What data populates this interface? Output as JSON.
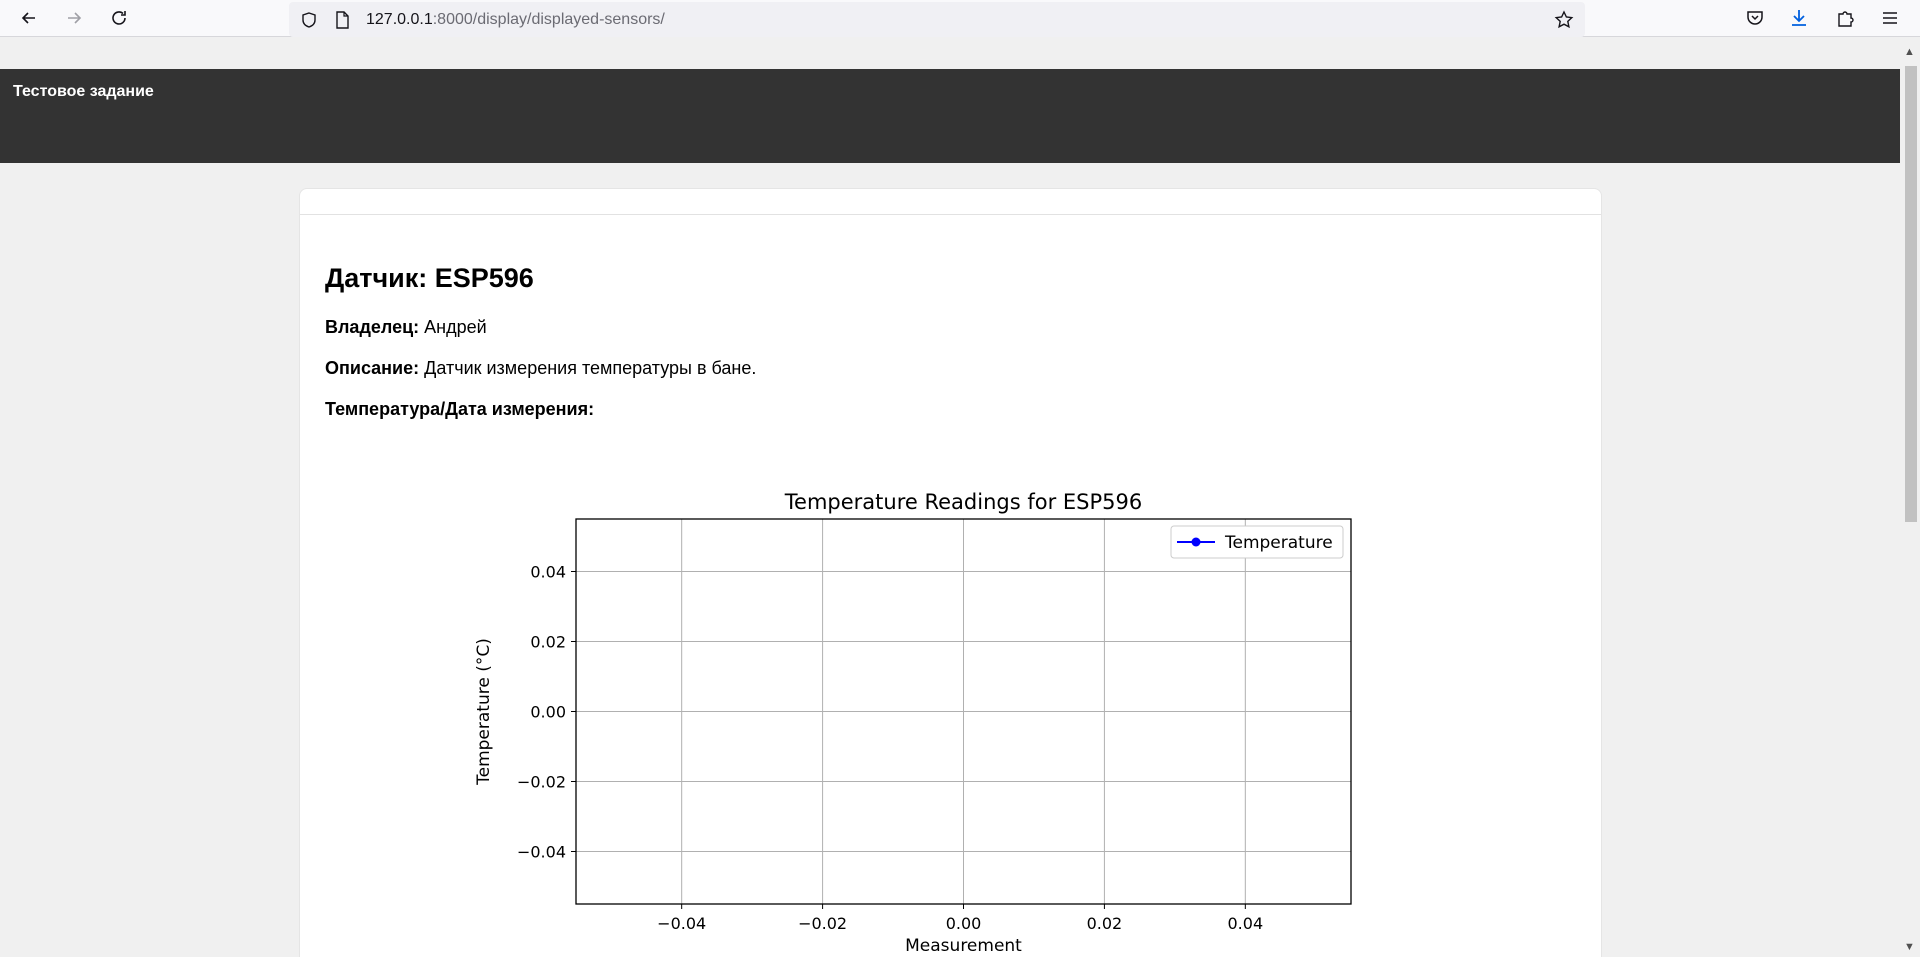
{
  "browser": {
    "url_host": "127.0.0.1",
    "url_rest": ":8000/display/displayed-sensors/"
  },
  "site": {
    "title": "Тестовое задание"
  },
  "sensor": {
    "heading": "Датчик: ESP596",
    "owner_label": "Владелец:",
    "owner_value": "Андрей",
    "description_label": "Описание:",
    "description_value": "Датчик измерения температуры в бане.",
    "readings_label": "Температура/Дата измерения:"
  },
  "chart_data": {
    "type": "line",
    "title": "Temperature Readings for ESP596",
    "xlabel": "Measurement",
    "ylabel": "Temperature (°C)",
    "xlim": [
      -0.055,
      0.055
    ],
    "ylim": [
      -0.055,
      0.055
    ],
    "x_ticks": [
      -0.04,
      -0.02,
      0.0,
      0.02,
      0.04
    ],
    "y_ticks": [
      -0.04,
      -0.02,
      0.0,
      0.02,
      0.04
    ],
    "x_tick_labels": [
      "−0.04",
      "−0.02",
      "0.00",
      "0.02",
      "0.04"
    ],
    "y_tick_labels": [
      "−0.04",
      "−0.02",
      "0.00",
      "0.02",
      "0.04"
    ],
    "grid": true,
    "legend_position": "top-right",
    "series": [
      {
        "name": "Temperature",
        "color": "#0000ff",
        "marker": "circle",
        "x": [],
        "values": []
      }
    ]
  }
}
